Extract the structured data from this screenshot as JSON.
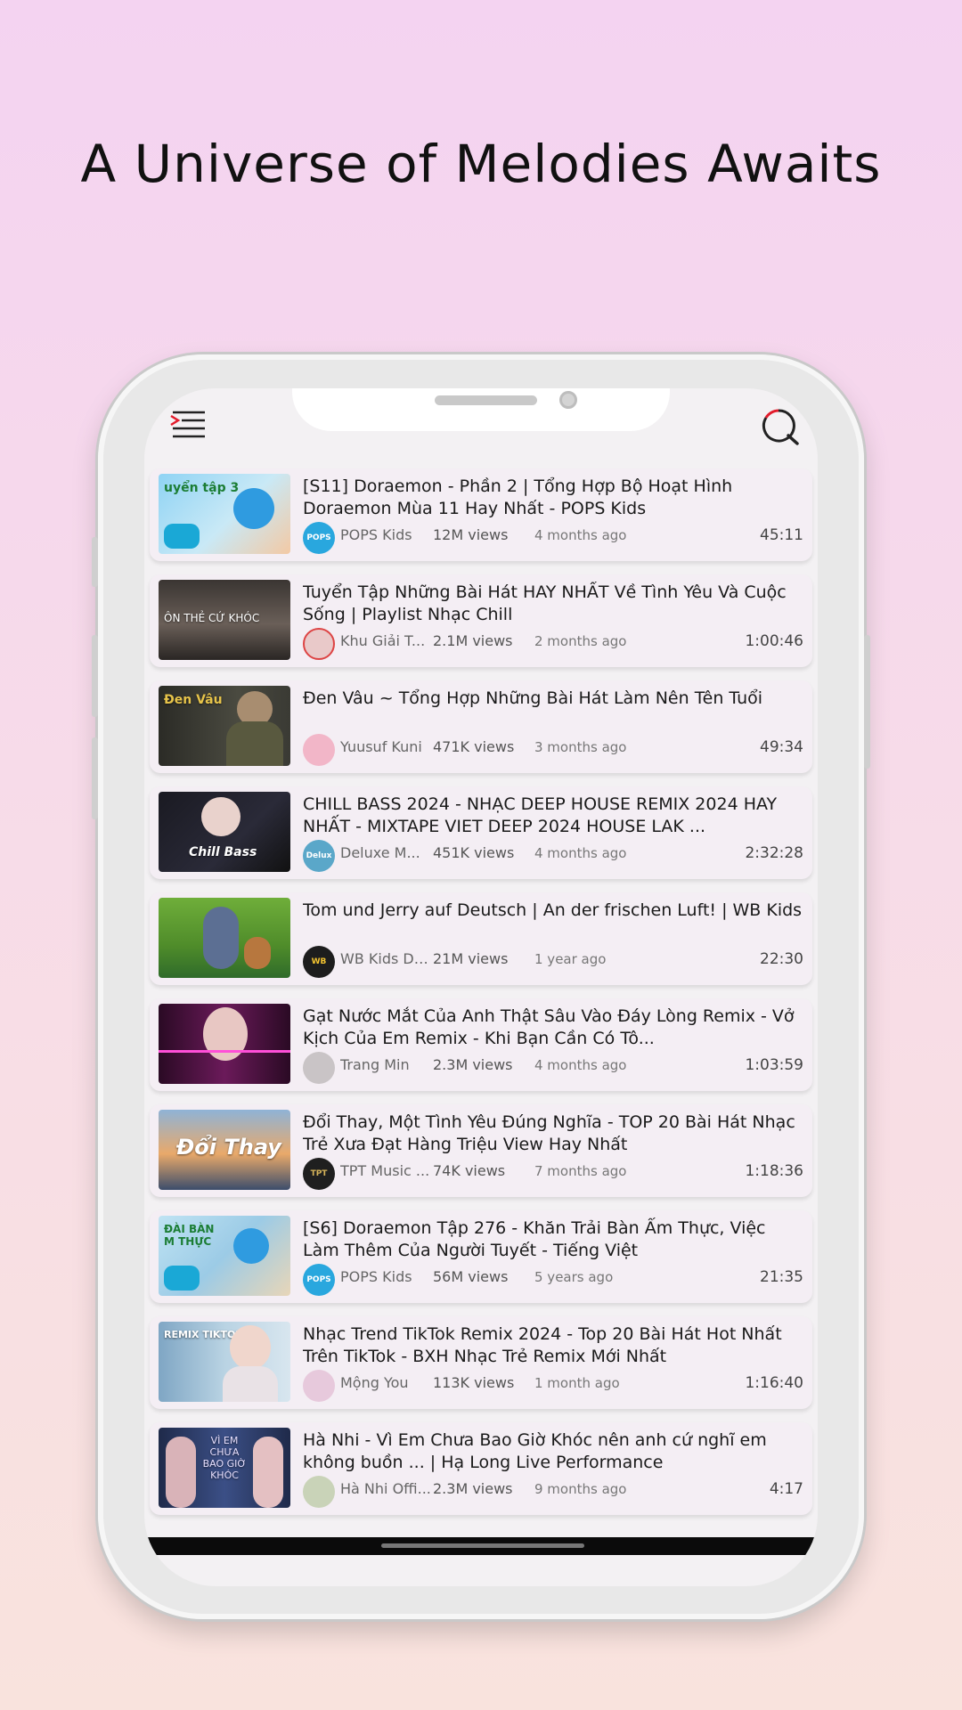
{
  "headline": "A Universe of Melodies Awaits",
  "header": {
    "menu_icon": "menu-icon",
    "search_icon": "search-icon"
  },
  "colors": {
    "accent": "#e21b2b",
    "card": "#f4eef4",
    "background_top": "#f4d3f1",
    "background_bottom": "#f9e3dd"
  },
  "videos": [
    {
      "title": "[S11] Doraemon - Phần 2 | Tổng Hợp Bộ Hoạt Hình Doraemon Mùa 11 Hay Nhất - POPS Kids",
      "channel": "POPS Kids",
      "views": "12M views",
      "ago": "4 months ago",
      "duration": "45:11",
      "thumb_text": "uyển tập 3"
    },
    {
      "title": "Tuyển Tập Những Bài Hát HAY NHẤT Về Tình Yêu Và Cuộc Sống | Playlist Nhạc Chill",
      "channel": "Khu Giải T...",
      "views": "2.1M views",
      "ago": "2 months ago",
      "duration": "1:00:46",
      "thumb_text": "ÔN THẺ CỨ KHÓC"
    },
    {
      "title": "Đen Vâu ~ Tổng Hợp Những Bài Hát Làm Nên Tên Tuổi",
      "channel": "Yuusuf Kuni",
      "views": "471K views",
      "ago": "3 months ago",
      "duration": "49:34",
      "thumb_text": "Đen Vâu"
    },
    {
      "title": "CHILL BASS 2024 - NHẠC DEEP HOUSE REMIX 2024 HAY NHẤT - MIXTAPE VIET DEEP 2024 HOUSE LAK ...",
      "channel": "Deluxe M...",
      "views": "451K views",
      "ago": "4 months ago",
      "duration": "2:32:28",
      "thumb_text": "Chill Bass"
    },
    {
      "title": "Tom und Jerry auf Deutsch | An der frischen Luft! | WB Kids",
      "channel": "WB Kids Deu...",
      "views": "21M views",
      "ago": "1 year ago",
      "duration": "22:30",
      "thumb_text": ""
    },
    {
      "title": "Gạt Nước Mắt Của Anh Thật Sâu Vào Đáy Lòng Remix - Vở Kịch Của Em Remix - Khi Bạn Cần Có Tô...",
      "channel": "Trang Min",
      "views": "2.3M views",
      "ago": "4 months ago",
      "duration": "1:03:59",
      "thumb_text": ""
    },
    {
      "title": "Đổi Thay, Một Tình Yêu Đúng Nghĩa - TOP 20 Bài Hát Nhạc Trẻ Xưa Đạt Hàng Triệu View Hay Nhất",
      "channel": "TPT Music ...",
      "views": "74K views",
      "ago": "7 months ago",
      "duration": "1:18:36",
      "thumb_text": "Đổi Thay"
    },
    {
      "title": "[S6] Doraemon Tập 276 - Khăn Trải Bàn Ẩm Thực, Việc Làm Thêm Của Người Tuyết - Tiếng Việt",
      "channel": "POPS Kids",
      "views": "56M views",
      "ago": "5 years ago",
      "duration": "21:35",
      "thumb_text": "ĐÀI BÀN M THỰC"
    },
    {
      "title": "Nhạc Trend TikTok Remix 2024 - Top 20 Bài Hát Hot Nhất Trên TikTok - BXH Nhạc Trẻ Remix Mới Nhất",
      "channel": "Mộng You",
      "views": "113K views",
      "ago": "1 month ago",
      "duration": "1:16:40",
      "thumb_text": "REMIX TIKTOK"
    },
    {
      "title": "Hà Nhi - Vì Em Chưa Bao Giờ Khóc nên anh cứ nghĩ em không buồn ... | Hạ Long Live Performance",
      "channel": "Hà Nhi Offi...",
      "views": "2.3M views",
      "ago": "9 months ago",
      "duration": "4:17",
      "thumb_text": "VÌ EM CHƯA BAO GIỜ KHÓC"
    }
  ]
}
